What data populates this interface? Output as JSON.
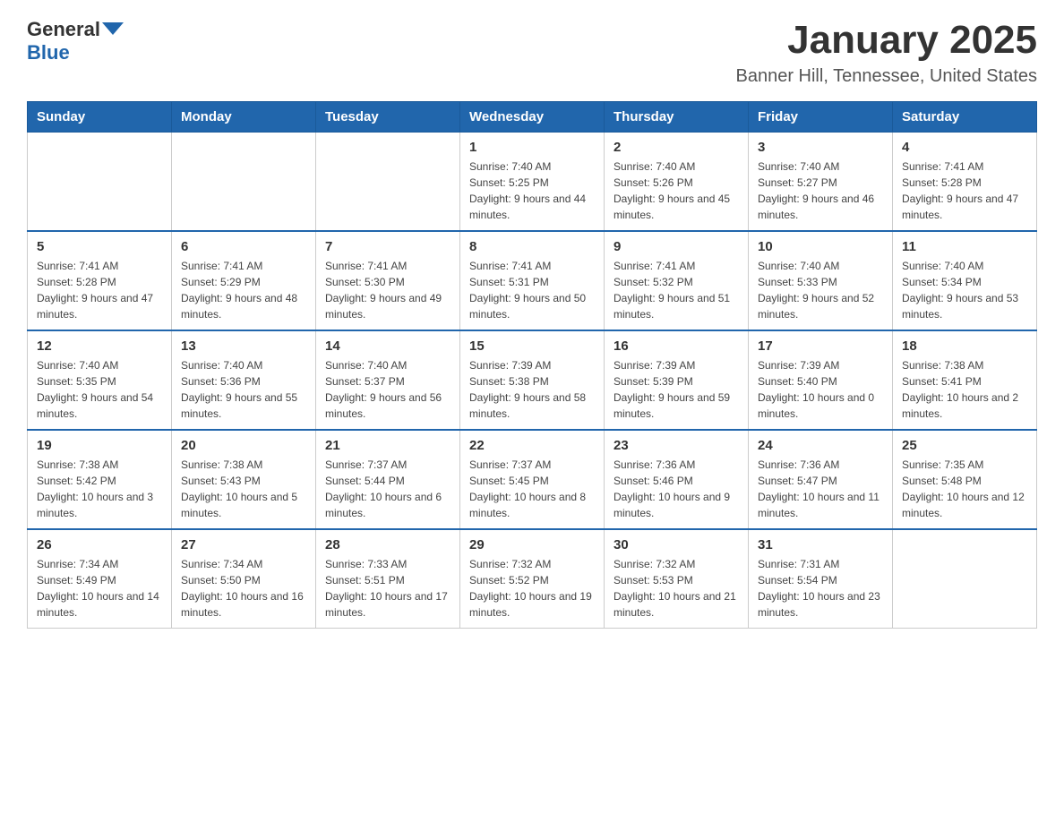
{
  "header": {
    "logo_general": "General",
    "logo_blue": "Blue",
    "title": "January 2025",
    "subtitle": "Banner Hill, Tennessee, United States"
  },
  "days": [
    "Sunday",
    "Monday",
    "Tuesday",
    "Wednesday",
    "Thursday",
    "Friday",
    "Saturday"
  ],
  "weeks": [
    [
      {
        "date": "",
        "info": ""
      },
      {
        "date": "",
        "info": ""
      },
      {
        "date": "",
        "info": ""
      },
      {
        "date": "1",
        "info": "Sunrise: 7:40 AM\nSunset: 5:25 PM\nDaylight: 9 hours and 44 minutes."
      },
      {
        "date": "2",
        "info": "Sunrise: 7:40 AM\nSunset: 5:26 PM\nDaylight: 9 hours and 45 minutes."
      },
      {
        "date": "3",
        "info": "Sunrise: 7:40 AM\nSunset: 5:27 PM\nDaylight: 9 hours and 46 minutes."
      },
      {
        "date": "4",
        "info": "Sunrise: 7:41 AM\nSunset: 5:28 PM\nDaylight: 9 hours and 47 minutes."
      }
    ],
    [
      {
        "date": "5",
        "info": "Sunrise: 7:41 AM\nSunset: 5:28 PM\nDaylight: 9 hours and 47 minutes."
      },
      {
        "date": "6",
        "info": "Sunrise: 7:41 AM\nSunset: 5:29 PM\nDaylight: 9 hours and 48 minutes."
      },
      {
        "date": "7",
        "info": "Sunrise: 7:41 AM\nSunset: 5:30 PM\nDaylight: 9 hours and 49 minutes."
      },
      {
        "date": "8",
        "info": "Sunrise: 7:41 AM\nSunset: 5:31 PM\nDaylight: 9 hours and 50 minutes."
      },
      {
        "date": "9",
        "info": "Sunrise: 7:41 AM\nSunset: 5:32 PM\nDaylight: 9 hours and 51 minutes."
      },
      {
        "date": "10",
        "info": "Sunrise: 7:40 AM\nSunset: 5:33 PM\nDaylight: 9 hours and 52 minutes."
      },
      {
        "date": "11",
        "info": "Sunrise: 7:40 AM\nSunset: 5:34 PM\nDaylight: 9 hours and 53 minutes."
      }
    ],
    [
      {
        "date": "12",
        "info": "Sunrise: 7:40 AM\nSunset: 5:35 PM\nDaylight: 9 hours and 54 minutes."
      },
      {
        "date": "13",
        "info": "Sunrise: 7:40 AM\nSunset: 5:36 PM\nDaylight: 9 hours and 55 minutes."
      },
      {
        "date": "14",
        "info": "Sunrise: 7:40 AM\nSunset: 5:37 PM\nDaylight: 9 hours and 56 minutes."
      },
      {
        "date": "15",
        "info": "Sunrise: 7:39 AM\nSunset: 5:38 PM\nDaylight: 9 hours and 58 minutes."
      },
      {
        "date": "16",
        "info": "Sunrise: 7:39 AM\nSunset: 5:39 PM\nDaylight: 9 hours and 59 minutes."
      },
      {
        "date": "17",
        "info": "Sunrise: 7:39 AM\nSunset: 5:40 PM\nDaylight: 10 hours and 0 minutes."
      },
      {
        "date": "18",
        "info": "Sunrise: 7:38 AM\nSunset: 5:41 PM\nDaylight: 10 hours and 2 minutes."
      }
    ],
    [
      {
        "date": "19",
        "info": "Sunrise: 7:38 AM\nSunset: 5:42 PM\nDaylight: 10 hours and 3 minutes."
      },
      {
        "date": "20",
        "info": "Sunrise: 7:38 AM\nSunset: 5:43 PM\nDaylight: 10 hours and 5 minutes."
      },
      {
        "date": "21",
        "info": "Sunrise: 7:37 AM\nSunset: 5:44 PM\nDaylight: 10 hours and 6 minutes."
      },
      {
        "date": "22",
        "info": "Sunrise: 7:37 AM\nSunset: 5:45 PM\nDaylight: 10 hours and 8 minutes."
      },
      {
        "date": "23",
        "info": "Sunrise: 7:36 AM\nSunset: 5:46 PM\nDaylight: 10 hours and 9 minutes."
      },
      {
        "date": "24",
        "info": "Sunrise: 7:36 AM\nSunset: 5:47 PM\nDaylight: 10 hours and 11 minutes."
      },
      {
        "date": "25",
        "info": "Sunrise: 7:35 AM\nSunset: 5:48 PM\nDaylight: 10 hours and 12 minutes."
      }
    ],
    [
      {
        "date": "26",
        "info": "Sunrise: 7:34 AM\nSunset: 5:49 PM\nDaylight: 10 hours and 14 minutes."
      },
      {
        "date": "27",
        "info": "Sunrise: 7:34 AM\nSunset: 5:50 PM\nDaylight: 10 hours and 16 minutes."
      },
      {
        "date": "28",
        "info": "Sunrise: 7:33 AM\nSunset: 5:51 PM\nDaylight: 10 hours and 17 minutes."
      },
      {
        "date": "29",
        "info": "Sunrise: 7:32 AM\nSunset: 5:52 PM\nDaylight: 10 hours and 19 minutes."
      },
      {
        "date": "30",
        "info": "Sunrise: 7:32 AM\nSunset: 5:53 PM\nDaylight: 10 hours and 21 minutes."
      },
      {
        "date": "31",
        "info": "Sunrise: 7:31 AM\nSunset: 5:54 PM\nDaylight: 10 hours and 23 minutes."
      },
      {
        "date": "",
        "info": ""
      }
    ]
  ]
}
